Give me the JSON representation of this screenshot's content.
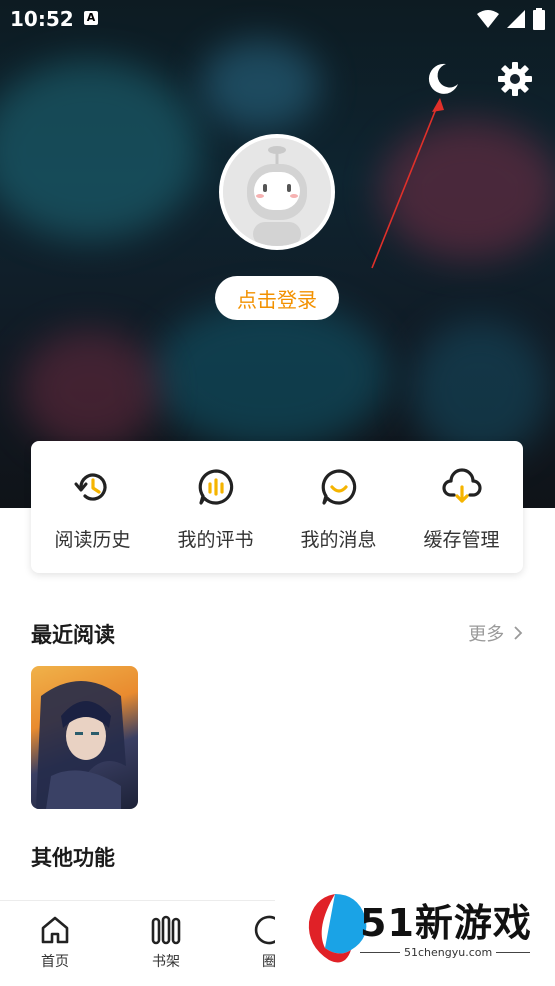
{
  "status": {
    "time": "10:52",
    "badge": "A"
  },
  "header": {
    "night_mode_icon": "moon-icon",
    "settings_icon": "gear-icon",
    "login_label": "点击登录"
  },
  "quick_actions": [
    {
      "label": "阅读历史",
      "icon": "history-icon"
    },
    {
      "label": "我的评书",
      "icon": "review-icon"
    },
    {
      "label": "我的消息",
      "icon": "message-icon"
    },
    {
      "label": "缓存管理",
      "icon": "cloud-download-icon"
    }
  ],
  "recent": {
    "title": "最近阅读",
    "more": "更多"
  },
  "other": {
    "title": "其他功能"
  },
  "tabs": [
    {
      "label": "首页",
      "icon": "home-icon"
    },
    {
      "label": "书架",
      "icon": "shelf-icon"
    },
    {
      "label": "圈",
      "icon": "circle-icon"
    }
  ],
  "watermark": {
    "brand": "51新游戏",
    "url": "51chengyu.com"
  },
  "colors": {
    "accent": "#f29100",
    "icon_yellow": "#f5b400"
  }
}
